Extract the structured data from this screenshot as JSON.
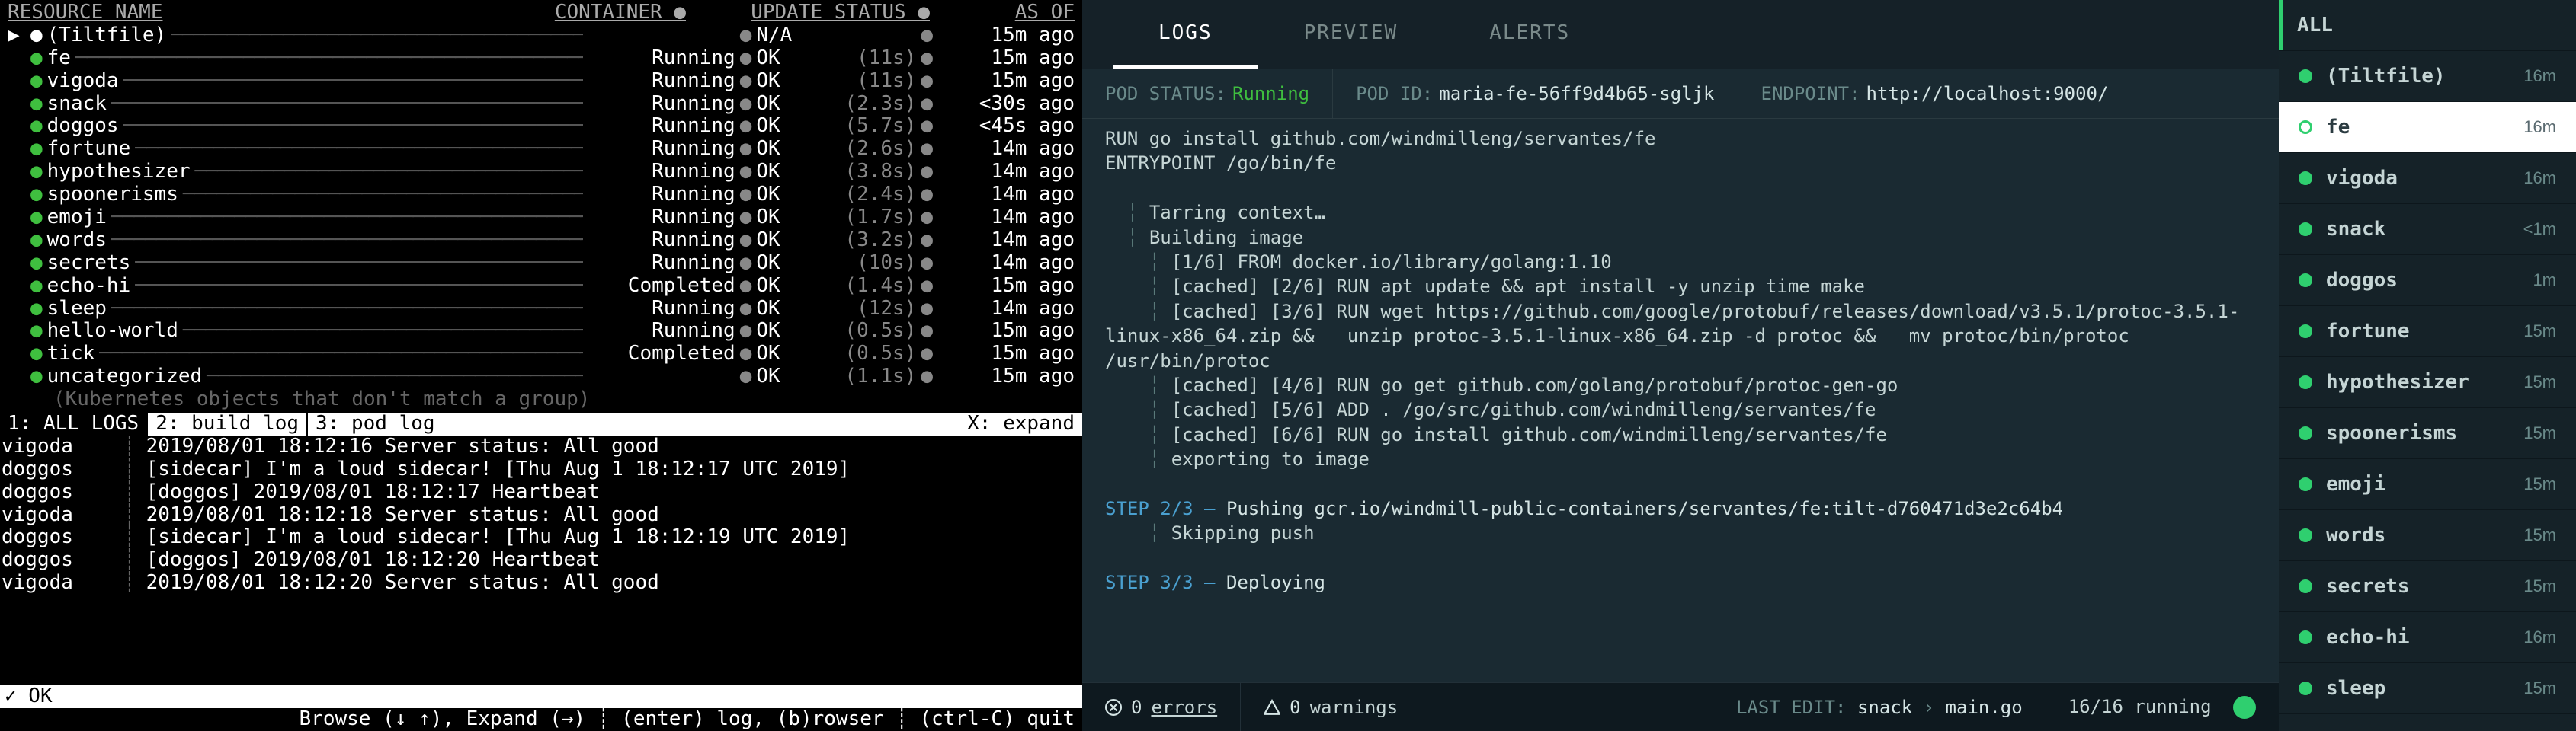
{
  "left": {
    "headers": {
      "name": "RESOURCE NAME",
      "container": "CONTAINER ●",
      "update": "UPDATE STATUS ●",
      "asof": "AS OF"
    },
    "rows": [
      {
        "marker": "▶",
        "dot": "white",
        "name": "(Tiltfile)",
        "container": "",
        "update": "N/A",
        "time": "",
        "asof": "15m ago"
      },
      {
        "dot": "green",
        "name": "fe",
        "container": "Running",
        "update": "OK",
        "time": "(11s)",
        "asof": "15m ago"
      },
      {
        "dot": "green",
        "name": "vigoda",
        "container": "Running",
        "update": "OK",
        "time": "(11s)",
        "asof": "15m ago"
      },
      {
        "dot": "green",
        "name": "snack",
        "container": "Running",
        "update": "OK",
        "time": "(2.3s)",
        "asof": "<30s ago"
      },
      {
        "dot": "green",
        "name": "doggos",
        "container": "Running",
        "update": "OK",
        "time": "(5.7s)",
        "asof": "<45s ago"
      },
      {
        "dot": "green",
        "name": "fortune",
        "container": "Running",
        "update": "OK",
        "time": "(2.6s)",
        "asof": "14m ago"
      },
      {
        "dot": "green",
        "name": "hypothesizer",
        "container": "Running",
        "update": "OK",
        "time": "(3.8s)",
        "asof": "14m ago"
      },
      {
        "dot": "green",
        "name": "spoonerisms",
        "container": "Running",
        "update": "OK",
        "time": "(2.4s)",
        "asof": "14m ago"
      },
      {
        "dot": "green",
        "name": "emoji",
        "container": "Running",
        "update": "OK",
        "time": "(1.7s)",
        "asof": "14m ago"
      },
      {
        "dot": "green",
        "name": "words",
        "container": "Running",
        "update": "OK",
        "time": "(3.2s)",
        "asof": "14m ago"
      },
      {
        "dot": "green",
        "name": "secrets",
        "container": "Running",
        "update": "OK",
        "time": "(10s)",
        "asof": "14m ago"
      },
      {
        "dot": "green",
        "name": "echo-hi",
        "container": "Completed",
        "update": "OK",
        "time": "(1.4s)",
        "asof": "15m ago"
      },
      {
        "dot": "green",
        "name": "sleep",
        "container": "Running",
        "update": "OK",
        "time": "(12s)",
        "asof": "14m ago"
      },
      {
        "dot": "green",
        "name": "hello-world",
        "container": "Running",
        "update": "OK",
        "time": "(0.5s)",
        "asof": "15m ago"
      },
      {
        "dot": "green",
        "name": "tick",
        "container": "Completed",
        "update": "OK",
        "time": "(0.5s)",
        "asof": "15m ago"
      },
      {
        "dot": "green",
        "name": "uncategorized",
        "container": "",
        "update": "OK",
        "time": "(1.1s)",
        "asof": "15m ago"
      }
    ],
    "note": "(Kubernetes objects that don't match a group)",
    "tabs": [
      "1: ALL LOGS",
      "2: build log",
      "3: pod log"
    ],
    "tab_expand": "X: expand",
    "logs": [
      {
        "src": "vigoda",
        "msg": "2019/08/01 18:12:16 Server status: All good"
      },
      {
        "src": "doggos",
        "msg": "[sidecar] I'm a loud sidecar! [Thu Aug  1 18:12:17 UTC 2019]"
      },
      {
        "src": "doggos",
        "msg": "[doggos] 2019/08/01 18:12:17 Heartbeat"
      },
      {
        "src": "vigoda",
        "msg": "2019/08/01 18:12:18 Server status: All good"
      },
      {
        "src": "doggos",
        "msg": "[sidecar] I'm a loud sidecar! [Thu Aug  1 18:12:19 UTC 2019]"
      },
      {
        "src": "doggos",
        "msg": "[doggos] 2019/08/01 18:12:20 Heartbeat"
      },
      {
        "src": "vigoda",
        "msg": "2019/08/01 18:12:20 Server status: All good"
      }
    ],
    "status": "✓ OK",
    "footer": "Browse (↓ ↑), Expand (→)  ┊ (enter) log, (b)rowser  ┊ (ctrl-C) quit"
  },
  "right": {
    "tabs": [
      "LOGS",
      "PREVIEW",
      "ALERTS"
    ],
    "info": {
      "pod_status_k": "POD STATUS:",
      "pod_status_v": "Running",
      "pod_id_k": "POD ID:",
      "pod_id_v": "maria-fe-56ff9d4b65-sgljk",
      "endpoint_k": "ENDPOINT:",
      "endpoint_v": "http://localhost:9000/"
    },
    "log_lines": [
      {
        "t": "plain",
        "txt": "RUN go install github.com/windmilleng/servantes/fe"
      },
      {
        "t": "plain",
        "txt": "ENTRYPOINT /go/bin/fe"
      },
      {
        "t": "blank",
        "txt": ""
      },
      {
        "t": "pipe1",
        "txt": "Tarring context…"
      },
      {
        "t": "pipe1",
        "txt": "Building image"
      },
      {
        "t": "pipe2",
        "txt": "[1/6] FROM docker.io/library/golang:1.10"
      },
      {
        "t": "pipe2",
        "txt": "[cached] [2/6] RUN apt update && apt install -y unzip time make"
      },
      {
        "t": "pipe2w",
        "txt": "[cached] [3/6] RUN wget https://github.com/google/protobuf/releases/download/v3.5.1/protoc-3.5.1-linux-x86_64.zip &&   unzip protoc-3.5.1-linux-x86_64.zip -d protoc &&   mv protoc/bin/protoc /usr/bin/protoc"
      },
      {
        "t": "pipe2",
        "txt": "[cached] [4/6] RUN go get github.com/golang/protobuf/protoc-gen-go"
      },
      {
        "t": "pipe2",
        "txt": "[cached] [5/6] ADD . /go/src/github.com/windmilleng/servantes/fe"
      },
      {
        "t": "pipe2",
        "txt": "[cached] [6/6] RUN go install github.com/windmilleng/servantes/fe"
      },
      {
        "t": "pipe2",
        "txt": "exporting to image"
      },
      {
        "t": "blank",
        "txt": ""
      },
      {
        "t": "step",
        "label": "STEP 2/3 —",
        "txt": "Pushing gcr.io/windmill-public-containers/servantes/fe:tilt-d760471d3e2c64b4"
      },
      {
        "t": "pipe2",
        "txt": "Skipping push"
      },
      {
        "t": "blank",
        "txt": ""
      },
      {
        "t": "step",
        "label": "STEP 3/3 —",
        "txt": "Deploying"
      }
    ],
    "bottom": {
      "errors_n": "0",
      "errors_l": "errors",
      "warnings_n": "0",
      "warnings_l": "warnings",
      "last_l": "LAST EDIT:",
      "last_v1": "snack",
      "last_sep": "›",
      "last_v2": "main.go",
      "running": "16/16 running"
    },
    "sidebar": [
      {
        "kind": "bar",
        "label": "ALL",
        "time": ""
      },
      {
        "kind": "dot",
        "label": "(Tiltfile)",
        "time": "16m"
      },
      {
        "kind": "sel",
        "label": "fe",
        "time": "16m"
      },
      {
        "kind": "dot",
        "label": "vigoda",
        "time": "16m"
      },
      {
        "kind": "dot",
        "label": "snack",
        "time": "<1m"
      },
      {
        "kind": "dot",
        "label": "doggos",
        "time": "1m"
      },
      {
        "kind": "dot",
        "label": "fortune",
        "time": "15m"
      },
      {
        "kind": "dot",
        "label": "hypothesizer",
        "time": "15m"
      },
      {
        "kind": "dot",
        "label": "spoonerisms",
        "time": "15m"
      },
      {
        "kind": "dot",
        "label": "emoji",
        "time": "15m"
      },
      {
        "kind": "dot",
        "label": "words",
        "time": "15m"
      },
      {
        "kind": "dot",
        "label": "secrets",
        "time": "15m"
      },
      {
        "kind": "dot",
        "label": "echo-hi",
        "time": "16m"
      },
      {
        "kind": "dot",
        "label": "sleep",
        "time": "15m"
      }
    ]
  }
}
